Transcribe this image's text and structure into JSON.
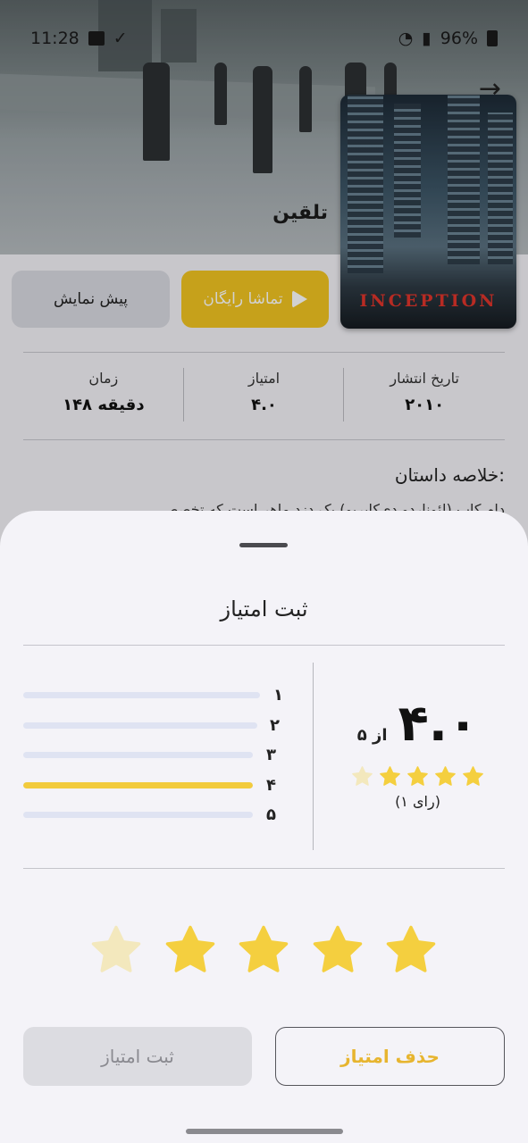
{
  "status_bar": {
    "time": "11:28",
    "battery": "96%"
  },
  "movie": {
    "title_fa": "تلقین",
    "poster_title": "INCEPTION"
  },
  "actions": {
    "preview_label": "پیش نمایش",
    "watch_label": "تماشا رایگان"
  },
  "info": [
    {
      "label": "تاریخ انتشار",
      "value": "۲۰۱۰"
    },
    {
      "label": "امتیاز",
      "value": "۴.۰"
    },
    {
      "label": "زمان",
      "value": "۱۴۸ دقیقه"
    }
  ],
  "summary": {
    "title": "خلاصه داستان:",
    "text": "دام کاب (لئوناردو دی‌کاپریو) یک دزد ماهر است که تخصص"
  },
  "rating_sheet": {
    "title": "ثبت امتیاز",
    "score": "۴.۰",
    "score_of": "از ۵",
    "stars_filled": 4,
    "stars_total": 5,
    "votes": "(۱ رای)",
    "distribution": [
      {
        "label": "۱",
        "fraction": 0
      },
      {
        "label": "۲",
        "fraction": 0
      },
      {
        "label": "۳",
        "fraction": 0
      },
      {
        "label": "۴",
        "fraction": 1
      },
      {
        "label": "۵",
        "fraction": 0
      }
    ],
    "selected_stars": 4,
    "submit_label": "ثبت امتیاز",
    "delete_label": "حذف امتیاز"
  },
  "colors": {
    "accent": "#f2c521",
    "star": "#f4cf3f",
    "star_empty": "#f3e8bd",
    "bar_track": "#dfe3f2",
    "delete_text": "#e7b52f"
  },
  "icons": [
    "back-arrow-icon",
    "play-icon",
    "star-icon",
    "image-icon",
    "battery-icon",
    "wifi-icon",
    "signal-icon"
  ]
}
